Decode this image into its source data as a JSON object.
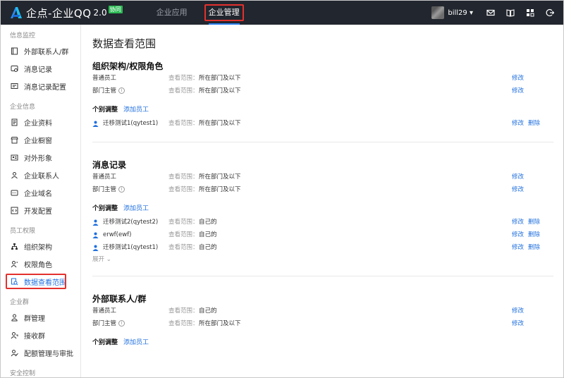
{
  "header": {
    "brand": "企点-企业QQ",
    "version": "2.0",
    "badge": "协同",
    "nav": [
      "企业应用",
      "企业管理"
    ],
    "username": "bill29",
    "accent": "#1f6fde",
    "highlight": "#e3312d"
  },
  "sidebar": {
    "groups": [
      {
        "label": "信息监控",
        "items": [
          {
            "label": "外部联系人/群",
            "icon": "contacts-book-icon"
          },
          {
            "label": "消息记录",
            "icon": "message-record-icon"
          },
          {
            "label": "消息记录配置",
            "icon": "message-config-icon"
          }
        ]
      },
      {
        "label": "企业信息",
        "items": [
          {
            "label": "企业资料",
            "icon": "document-icon"
          },
          {
            "label": "企业橱窗",
            "icon": "shop-window-icon"
          },
          {
            "label": "对外形象",
            "icon": "id-card-icon"
          },
          {
            "label": "企业联系人",
            "icon": "contact-person-icon"
          },
          {
            "label": "企业域名",
            "icon": "domain-icon"
          },
          {
            "label": "开发配置",
            "icon": "code-icon"
          }
        ]
      },
      {
        "label": "员工权限",
        "items": [
          {
            "label": "组织架构",
            "icon": "org-chart-icon"
          },
          {
            "label": "权限角色",
            "icon": "role-icon"
          },
          {
            "label": "数据查看范围",
            "icon": "data-scope-icon"
          }
        ]
      },
      {
        "label": "企业群",
        "items": [
          {
            "label": "群管理",
            "icon": "group-manage-icon"
          },
          {
            "label": "接收群",
            "icon": "group-receive-icon"
          },
          {
            "label": "配额管理与审批",
            "icon": "quota-icon"
          }
        ]
      },
      {
        "label": "安全控制",
        "items": []
      }
    ]
  },
  "main": {
    "title": "数据查看范围",
    "scope_label": "查看范围：",
    "edit": "修改",
    "delete": "删除",
    "individual_label": "个别调整",
    "add_employee": "添加员工",
    "expand": "展开",
    "sections": [
      {
        "title": "组织架构/权限角色",
        "roles": [
          {
            "role": "普通员工",
            "scope": "所在部门及以下"
          },
          {
            "role": "部门主管",
            "scope": "所在部门及以下"
          }
        ],
        "people": [
          {
            "name": "迁移测试1(qytest1)",
            "scope": "所在部门及以下"
          }
        ]
      },
      {
        "title": "消息记录",
        "roles": [
          {
            "role": "普通员工",
            "scope": "所在部门及以下"
          },
          {
            "role": "部门主管",
            "scope": "所在部门及以下"
          }
        ],
        "people": [
          {
            "name": "迁移测试2(qytest2)",
            "scope": "自己的"
          },
          {
            "name": "erwf(ewf)",
            "scope": "自己的"
          },
          {
            "name": "迁移测试1(qytest1)",
            "scope": "自己的"
          }
        ]
      },
      {
        "title": "外部联系人/群",
        "roles": [
          {
            "role": "普通员工",
            "scope": "自己的"
          },
          {
            "role": "部门主管",
            "scope": "所在部门及以下"
          }
        ],
        "people": []
      }
    ]
  }
}
